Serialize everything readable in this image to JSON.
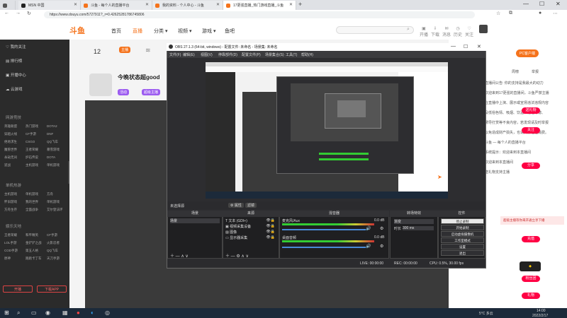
{
  "browser": {
    "tabs": [
      {
        "label": "MSN 中国"
      },
      {
        "label": "斗鱼 - 每个人的直播平台"
      },
      {
        "label": "我的资料 - 个人中心 - 斗鱼"
      },
      {
        "label": "17更强直播_热门游戏直播_斗鱼"
      }
    ],
    "new_tab": "+",
    "url": "https://www.douyu.com/5727911?_r=0.42625281786745806",
    "win_controls": [
      "—",
      "☐",
      "✕"
    ]
  },
  "douyu": {
    "logo": "斗鱼",
    "nav": [
      "首页",
      "直播",
      "分类 ▾",
      "视频 ▾",
      "游戏 ▾",
      "鱼吧"
    ],
    "search_placeholder": "",
    "header_icons": [
      "开播",
      "下载",
      "消息",
      "历史",
      "关注"
    ],
    "sidebar": {
      "items": [
        "我的关注",
        "排行榜",
        "开播中心",
        "云游戏"
      ],
      "section1": "网游竞技",
      "grid1": [
        "英雄联盟",
        "热门游戏",
        "DOTA2",
        "穿越火线",
        "CF手游",
        "DNF",
        "绝地求生",
        "CSGO",
        "QQ飞车",
        "魔兽世界",
        "王者荣耀",
        "暴雪游戏",
        "永劫无间",
        "炉石传说",
        "DOTA",
        "逆战",
        "主机游戏",
        "单机游戏"
      ],
      "section2": "单机热游",
      "grid2": [
        "主机游戏",
        "单机游戏",
        "方舟",
        "怀旧游戏",
        "我的世界",
        "单机游戏",
        "方舟生存",
        "全面战争",
        "艾尔登法环"
      ],
      "section3": "娱乐天地",
      "grid3": [
        "王者荣耀",
        "和平精英",
        "CF手游",
        "LOL手游",
        "金铲铲之战",
        "火影忍者",
        "COD手游",
        "第五人格",
        "QQ飞车",
        "原神",
        "跑跑卡丁车",
        "天刀手游"
      ],
      "btn_left": "开播",
      "btn_right": "下载APP"
    },
    "room": {
      "counter": "12",
      "streamer": "今晚状态超good",
      "badge1": "主播",
      "badge2": "活动",
      "tag": "超级主播"
    },
    "right": {
      "pc_client": "PC客户端",
      "rank": "周榜",
      "report": "举报",
      "chat_lines": [
        "直播间公告: 你的支持是我最大的动力",
        "欢迎来到17更强的直播间，斗鱼严禁主播",
        "在直播中上演、展示或宣扬违法违规内容",
        "及低俗色情、吸烟、饮酒、造谣诽谤、",
        "诱导打赏等不良内容，若发现请及时举报",
        "以免造成财产损失，也请大家理性消费。",
        "斗鱼 — 每个人的直播平台",
        "系统提示：欢迎来到本直播间",
        "欢迎来到本直播间",
        "送礼物支持主播"
      ],
      "promo": "超级主播等你来开通立享下播",
      "red_buttons": [
        "主播榜",
        "送礼物",
        "关注",
        "分享",
        "充值",
        "粉丝团",
        "礼物"
      ]
    }
  },
  "obs": {
    "title": "OBS 27.1.3 (64-bit, windows) - 配置文件: 未命名 - 场景集: 未命名",
    "menu": [
      "文件(F)",
      "编辑(E)",
      "视图(V)",
      "停靠部件(D)",
      "配置文件(P)",
      "场景集合(S)",
      "工具(T)",
      "帮助(H)"
    ],
    "scene_bar": {
      "label": "未选择源",
      "props": "⚙ 属性",
      "filters": "滤镜"
    },
    "docks": {
      "scenes": "场景",
      "sources": "来源",
      "mixer": "混音器",
      "transitions": "转场特效",
      "controls": "控件"
    },
    "scene_items": [
      "场景"
    ],
    "source_items": [
      "文本 (GDI+)",
      "视频采集设备",
      "图像",
      "显示器采集"
    ],
    "mixer": {
      "desktop": "桌面音频",
      "desktop_db": "0.0 dB",
      "mic": "麦克风/Aux",
      "mic_db": "0.0 dB"
    },
    "transition": {
      "type": "渐变",
      "duration_label": "时长",
      "duration": "300 ms"
    },
    "controls": [
      "停止录制",
      "开始录制",
      "启动虚拟摄像机",
      "工作室模式",
      "设置",
      "退出"
    ],
    "status": {
      "live": "LIVE: 00:00:00",
      "rec": "REC: 00:00:00",
      "cpu": "CPU: 0.5%, 30.00 fps"
    }
  },
  "taskbar": {
    "weather": "5°C 多云",
    "time": "14:00",
    "date": "2022/2/17"
  }
}
